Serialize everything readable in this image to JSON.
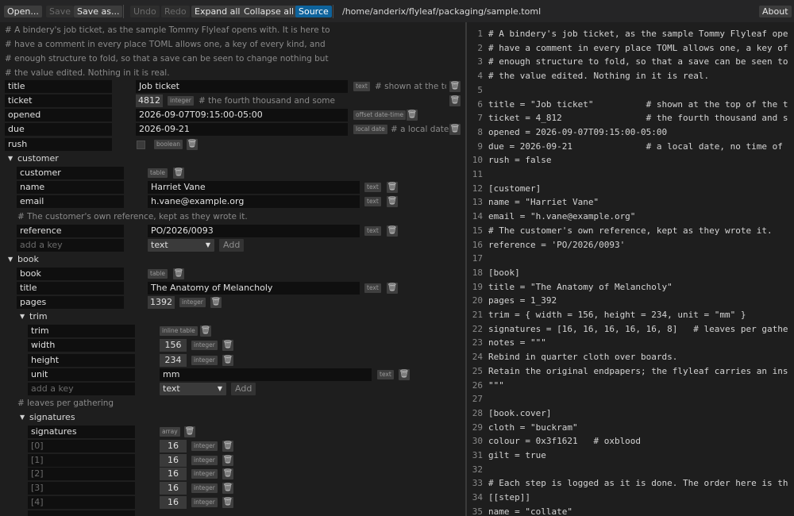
{
  "toolbar": {
    "open": "Open...",
    "save": "Save",
    "save_as": "Save as...",
    "undo": "Undo",
    "redo": "Redo",
    "expand_all": "Expand all",
    "collapse_all": "Collapse all",
    "source": "Source",
    "file_path": "/home/anderix/flyleaf/packaging/sample.toml",
    "about": "About"
  },
  "tree": {
    "header_comments": [
      "#  A bindery's job ticket, as the sample Tommy Flyleaf opens with. It is here to",
      "#  have a comment in every place TOML allows one, a key of every kind, and",
      "#  enough structure to fold, so that a save can be seen to change nothing but",
      "#  the value edited. Nothing in it is real."
    ],
    "title_row": {
      "key": "title",
      "value": "Job ticket",
      "type": "text",
      "comment": "#  shown at the top of the ticket"
    },
    "ticket_row": {
      "key": "ticket",
      "value": "4812",
      "type": "integer",
      "comment": "#  the fourth thousand and some"
    },
    "opened_row": {
      "key": "opened",
      "value": "2026-09-07T09:15:00-05:00",
      "type": "offset date-time"
    },
    "due_row": {
      "key": "due",
      "value": "2026-09-21",
      "type": "local date",
      "comment": "#  a local date"
    },
    "rush_row": {
      "key": "rush",
      "type": "boolean"
    },
    "customer": {
      "section": "customer",
      "table_key": "customer",
      "table_type": "table",
      "name": {
        "key": "name",
        "value": "Harriet Vane",
        "type": "text"
      },
      "email": {
        "key": "email",
        "value": "h.vane@example.org",
        "type": "text"
      },
      "ref_comment": "#  The customer's own reference, kept as they wrote it.",
      "reference": {
        "key": "reference",
        "value": "PO/2026/0093",
        "type": "text"
      },
      "add_placeholder": "add a key",
      "add_type": "text",
      "add_button": "Add"
    },
    "book": {
      "section": "book",
      "table_key": "book",
      "table_type": "table",
      "title": {
        "key": "title",
        "value": "The Anatomy of Melancholy",
        "type": "text"
      },
      "pages": {
        "key": "pages",
        "value": "1392",
        "type": "integer"
      },
      "trim": {
        "section": "trim",
        "table_key": "trim",
        "table_type": "inline table",
        "width": {
          "key": "width",
          "value": "156",
          "type": "integer"
        },
        "height": {
          "key": "height",
          "value": "234",
          "type": "integer"
        },
        "unit": {
          "key": "unit",
          "value": "mm",
          "type": "text"
        },
        "add_placeholder": "add a key",
        "add_type": "text",
        "add_button": "Add"
      },
      "sig_comment": "#  leaves per gathering",
      "signatures": {
        "section": "signatures",
        "array_key": "signatures",
        "array_type": "array",
        "items": [
          {
            "index": "[0]",
            "value": "16",
            "type": "integer"
          },
          {
            "index": "[1]",
            "value": "16",
            "type": "integer"
          },
          {
            "index": "[2]",
            "value": "16",
            "type": "integer"
          },
          {
            "index": "[3]",
            "value": "16",
            "type": "integer"
          },
          {
            "index": "[4]",
            "value": "16",
            "type": "integer"
          }
        ]
      }
    }
  },
  "source": {
    "lines": [
      {
        "n": "1",
        "t": "# A bindery's job ticket, as the sample Tommy Flyleaf ope"
      },
      {
        "n": "2",
        "t": "# have a comment in every place TOML allows one, a key of"
      },
      {
        "n": "3",
        "t": "# enough structure to fold, so that a save can be seen to"
      },
      {
        "n": "4",
        "t": "# the value edited. Nothing in it is real."
      },
      {
        "n": "5",
        "t": ""
      },
      {
        "n": "6",
        "t": "title = \"Job ticket\"          # shown at the top of the t"
      },
      {
        "n": "7",
        "t": "ticket = 4_812                # the fourth thousand and s"
      },
      {
        "n": "8",
        "t": "opened = 2026-09-07T09:15:00-05:00"
      },
      {
        "n": "9",
        "t": "due = 2026-09-21              # a local date, no time of"
      },
      {
        "n": "10",
        "t": "rush = false"
      },
      {
        "n": "11",
        "t": ""
      },
      {
        "n": "12",
        "t": "[customer]"
      },
      {
        "n": "13",
        "t": "name = \"Harriet Vane\""
      },
      {
        "n": "14",
        "t": "email = \"h.vane@example.org\""
      },
      {
        "n": "15",
        "t": "# The customer's own reference, kept as they wrote it."
      },
      {
        "n": "16",
        "t": "reference = 'PO/2026/0093'"
      },
      {
        "n": "17",
        "t": ""
      },
      {
        "n": "18",
        "t": "[book]"
      },
      {
        "n": "19",
        "t": "title = \"The Anatomy of Melancholy\""
      },
      {
        "n": "20",
        "t": "pages = 1_392"
      },
      {
        "n": "21",
        "t": "trim = { width = 156, height = 234, unit = \"mm\" }"
      },
      {
        "n": "22",
        "t": "signatures = [16, 16, 16, 16, 16, 8]   # leaves per gathe"
      },
      {
        "n": "23",
        "t": "notes = \"\"\""
      },
      {
        "n": "24",
        "t": "Rebind in quarter cloth over boards."
      },
      {
        "n": "25",
        "t": "Retain the original endpapers; the flyleaf carries an ins"
      },
      {
        "n": "26",
        "t": "\"\"\""
      },
      {
        "n": "27",
        "t": ""
      },
      {
        "n": "28",
        "t": "[book.cover]"
      },
      {
        "n": "29",
        "t": "cloth = \"buckram\""
      },
      {
        "n": "30",
        "t": "colour = 0x3f1621   # oxblood"
      },
      {
        "n": "31",
        "t": "gilt = true"
      },
      {
        "n": "32",
        "t": ""
      },
      {
        "n": "33",
        "t": "# Each step is logged as it is done. The order here is th"
      },
      {
        "n": "34",
        "t": "[[step]]"
      },
      {
        "n": "35",
        "t": "name = \"collate\""
      }
    ]
  }
}
